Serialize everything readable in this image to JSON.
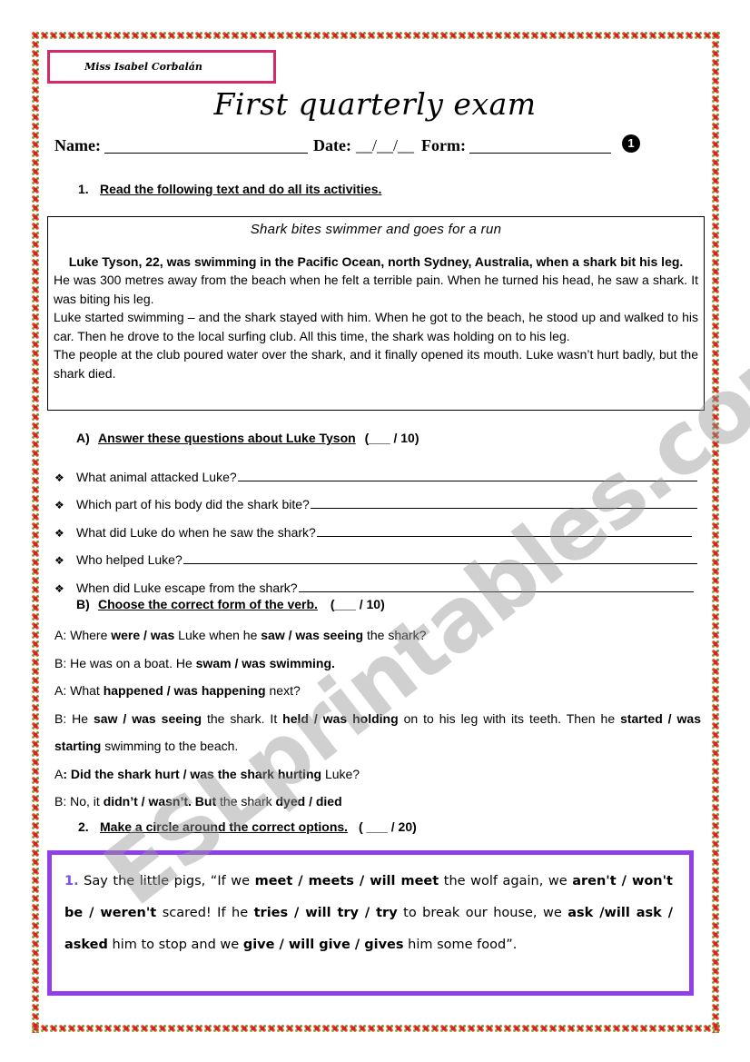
{
  "header": {
    "teacher_name": "Miss Isabel Corbalán",
    "title": "First quarterly exam",
    "name_label": "Name:",
    "date_label": "Date:",
    "date_blank": "__/__/__",
    "form_label": "Form:",
    "page_badge": "1"
  },
  "section1": {
    "number": "1.",
    "heading": "Read the following text and do all its activities.",
    "reading": {
      "title": "Shark bites swimmer and goes for a run",
      "lead": "Luke Tyson, 22, was swimming in the Pacific Ocean, north Sydney, Australia, when a shark bit his leg.",
      "paragraphs": [
        "He was 300 metres away from the beach when he felt a terrible pain. When he turned his head, he saw a shark. It was biting his leg.",
        "Luke started swimming – and the shark stayed with him. When he got to the beach, he stood up and walked to his car. Then he drove to the local surfing club. All this time, the shark was holding on to his leg.",
        "The people at the club poured water over the shark, and it finally opened its mouth. Luke wasn’t hurt badly, but the shark died."
      ]
    },
    "partA": {
      "letter": "A)",
      "heading": "Answer these questions about Luke Tyson",
      "score": "(___ / 10)",
      "questions": [
        "What animal attacked Luke?",
        "Which part of his body did the shark bite?",
        "What did Luke do when he saw the shark?",
        "Who helped Luke?",
        "When did Luke escape from the shark?"
      ]
    },
    "partB": {
      "letter": "B)",
      "heading": "Choose the correct form of the verb.",
      "score": "(___ / 10)",
      "lines": [
        [
          {
            "t": "A: Where ",
            "b": false
          },
          {
            "t": "were / was",
            "b": true
          },
          {
            "t": " Luke when he ",
            "b": false
          },
          {
            "t": "saw / was seeing",
            "b": true
          },
          {
            "t": " the shark?",
            "b": false
          }
        ],
        [
          {
            "t": "B: He was on a boat. He ",
            "b": false
          },
          {
            "t": "swam / was swimming.",
            "b": true
          }
        ],
        [
          {
            "t": "A: What ",
            "b": false
          },
          {
            "t": "happened / was happening",
            "b": true
          },
          {
            "t": " next?",
            "b": false
          }
        ],
        [
          {
            "t": "B: He ",
            "b": false
          },
          {
            "t": "saw / was seeing",
            "b": true
          },
          {
            "t": " the shark. It ",
            "b": false
          },
          {
            "t": "held / was holding",
            "b": true
          },
          {
            "t": " on to his leg with its teeth. Then he ",
            "b": false
          },
          {
            "t": "started / was starting",
            "b": true
          },
          {
            "t": " swimming to the beach.",
            "b": false
          }
        ],
        [
          {
            "t": "A",
            "b": false
          },
          {
            "t": ": Did the shark hurt / was the shark hurting",
            "b": true
          },
          {
            "t": " Luke?",
            "b": false
          }
        ],
        [
          {
            "t": "B: No, it ",
            "b": false
          },
          {
            "t": "didn’t / wasn’t. But",
            "b": true
          },
          {
            "t": " the shark ",
            "b": false
          },
          {
            "t": "dyed / died",
            "b": true
          }
        ]
      ]
    }
  },
  "section2": {
    "number": "2.",
    "heading": "Make a circle around the correct options.",
    "score": "( ___ / 20)",
    "item_number": "1.",
    "item_parts": [
      {
        "t": " Say the little pigs, “If we ",
        "b": false
      },
      {
        "t": "meet / meets / will meet",
        "b": true
      },
      {
        "t": " the wolf again, we ",
        "b": false
      },
      {
        "t": "aren't / won't be / weren't",
        "b": true
      },
      {
        "t": " scared! If he ",
        "b": false
      },
      {
        "t": "tries / will try / try",
        "b": true
      },
      {
        "t": " to break our house, we ",
        "b": false
      },
      {
        "t": "ask /will ask / asked",
        "b": true
      },
      {
        "t": " him to stop and we ",
        "b": false
      },
      {
        "t": "give / will give / gives",
        "b": true
      },
      {
        "t": " him some food”.",
        "b": false
      }
    ]
  },
  "watermark": "ESLprintables.com",
  "colors": {
    "teacher_box_border": "#d42a6b",
    "circle_box_border": "#9040e8",
    "item_number": "#7b4ee0"
  }
}
